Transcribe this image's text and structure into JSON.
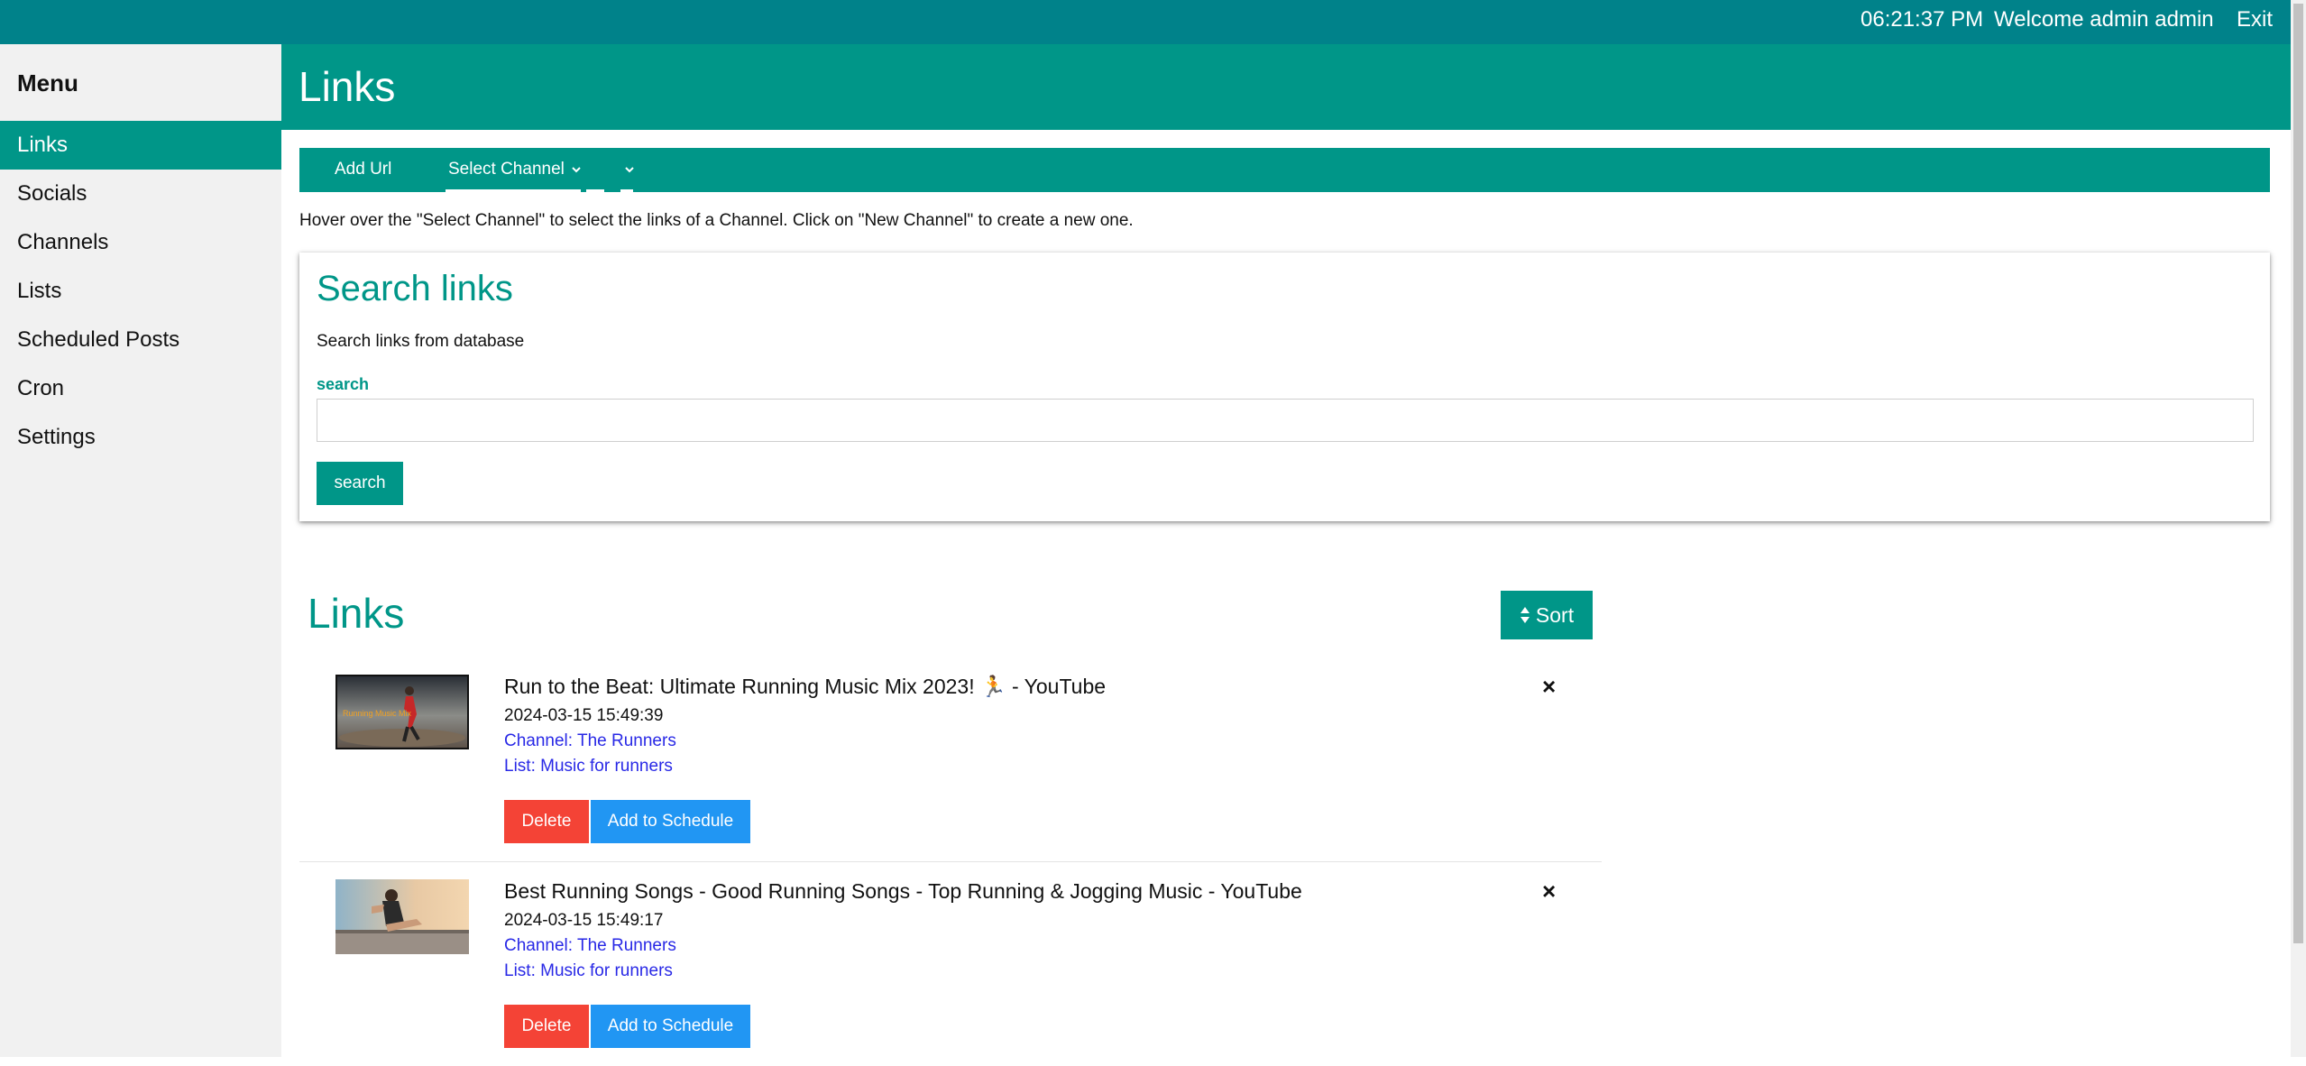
{
  "topbar": {
    "time": "06:21:37 PM",
    "welcome": "Welcome admin admin",
    "exit": "Exit"
  },
  "sidebar": {
    "title": "Menu",
    "items": [
      {
        "label": "Links",
        "active": true
      },
      {
        "label": "Socials"
      },
      {
        "label": "Channels"
      },
      {
        "label": "Lists"
      },
      {
        "label": "Scheduled Posts"
      },
      {
        "label": "Cron"
      },
      {
        "label": "Settings"
      }
    ]
  },
  "header": {
    "title": "Links"
  },
  "toolbar": {
    "add_url": "Add Url",
    "select_channel": "Select Channel"
  },
  "hint": "Hover over the \"Select Channel\" to select the links of a Channel. Click on \"New Channel\" to create a new one.",
  "search_card": {
    "title": "Search links",
    "description": "Search links from database",
    "label": "search",
    "input_value": "",
    "button": "search"
  },
  "links_section": {
    "title": "Links",
    "sort_label": "Sort"
  },
  "links": [
    {
      "title": "Run to the Beat: Ultimate Running Music Mix 2023! 🏃 - YouTube",
      "date": "2024-03-15 15:49:39",
      "channel": "Channel: The Runners",
      "list": "List: Music for runners",
      "thumb_text": "Running Music Mix",
      "delete": "Delete",
      "schedule": "Add to Schedule",
      "close": "×"
    },
    {
      "title": "Best Running Songs - Good Running Songs - Top Running & Jogging Music - YouTube",
      "date": "2024-03-15 15:49:17",
      "channel": "Channel: The Runners",
      "list": "List: Music for runners",
      "delete": "Delete",
      "schedule": "Add to Schedule",
      "close": "×"
    }
  ],
  "colors": {
    "teal": "#009688",
    "topbar": "#00828a",
    "delete": "#f44336",
    "schedule": "#2196f3",
    "link": "#2929e6"
  }
}
